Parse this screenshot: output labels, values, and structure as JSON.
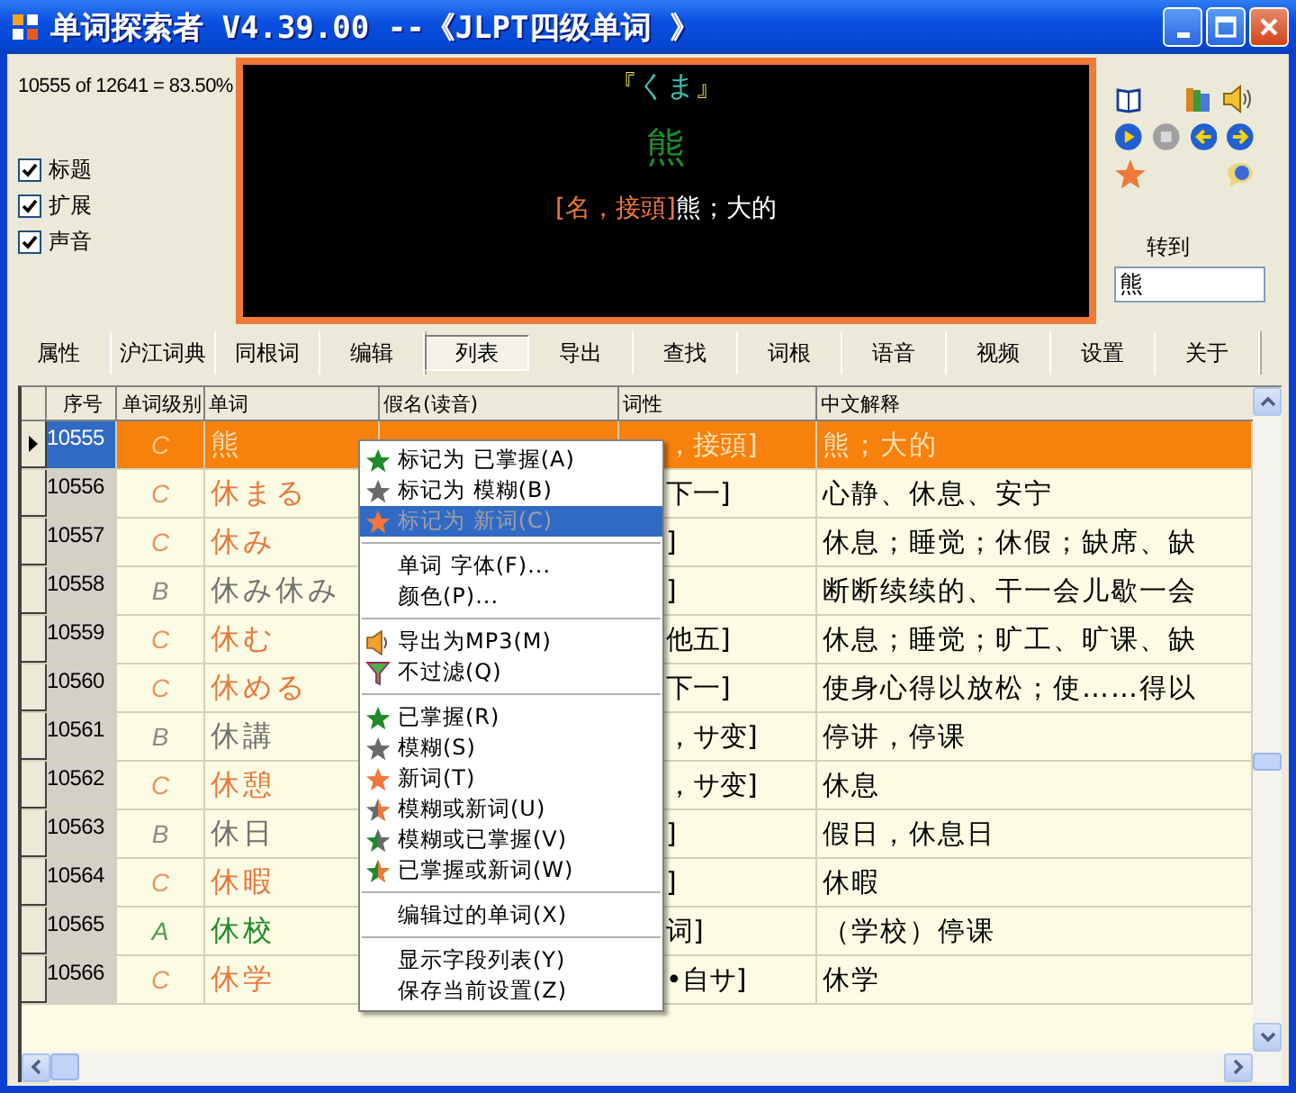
{
  "window": {
    "title": "单词探索者 V4.39.00 --《JLPT四级单词 》"
  },
  "stats": "10555 of 12641 = 83.50%",
  "options": [
    {
      "label": "标题",
      "checked": true
    },
    {
      "label": "扩展",
      "checked": true
    },
    {
      "label": "声音",
      "checked": true
    }
  ],
  "display": {
    "reading_open": "『",
    "reading": "くま",
    "reading_close": "』",
    "word": "熊",
    "pos": "[名，接頭]",
    "meaning": "熊；大的"
  },
  "goto": {
    "label": "转到",
    "value": "熊"
  },
  "tabs": [
    {
      "label": "属性",
      "selected": false
    },
    {
      "label": "沪江词典",
      "selected": false
    },
    {
      "label": "同根词",
      "selected": false
    },
    {
      "label": "编辑",
      "selected": false
    },
    {
      "label": "列表",
      "selected": true
    },
    {
      "label": "导出",
      "selected": false
    },
    {
      "label": "查找",
      "selected": false
    },
    {
      "label": "词根",
      "selected": false
    },
    {
      "label": "语音",
      "selected": false
    },
    {
      "label": "视频",
      "selected": false
    },
    {
      "label": "设置",
      "selected": false
    },
    {
      "label": "关于",
      "selected": false
    }
  ],
  "table": {
    "columns": [
      "序号",
      "单词级别",
      "单词",
      "假名(读音)",
      "词性",
      "中文解释"
    ],
    "rows": [
      {
        "id": "10555",
        "level": "C",
        "word": "熊",
        "pos": "，接頭]",
        "meaning": "熊；大的",
        "color": "#ffd9a8",
        "selected": true
      },
      {
        "id": "10556",
        "level": "C",
        "word": "休まる",
        "pos": "下一]",
        "meaning": "心静、休息、安宁",
        "color": "#e8783c",
        "selected": false
      },
      {
        "id": "10557",
        "level": "C",
        "word": "休み",
        "pos": "]",
        "meaning": "休息；睡觉；休假；缺席、缺",
        "color": "#e8783c",
        "selected": false
      },
      {
        "id": "10558",
        "level": "B",
        "word": "休み休み",
        "pos": "]",
        "meaning": "断断续续的、干一会儿歇一会",
        "color": "#707070",
        "selected": false
      },
      {
        "id": "10559",
        "level": "C",
        "word": "休む",
        "pos": "他五]",
        "meaning": "休息；睡觉；旷工、旷课、缺",
        "color": "#e8783c",
        "selected": false
      },
      {
        "id": "10560",
        "level": "C",
        "word": "休める",
        "pos": "下一]",
        "meaning": "使身心得以放松；使……得以",
        "color": "#e8783c",
        "selected": false
      },
      {
        "id": "10561",
        "level": "B",
        "word": "休講",
        "pos": "，サ变]",
        "meaning": "停讲，停课",
        "color": "#707070",
        "selected": false
      },
      {
        "id": "10562",
        "level": "C",
        "word": "休憩",
        "pos": "，サ变]",
        "meaning": "休息",
        "color": "#e8783c",
        "selected": false
      },
      {
        "id": "10563",
        "level": "B",
        "word": "休日",
        "pos": "]",
        "meaning": "假日，休息日",
        "color": "#707070",
        "selected": false
      },
      {
        "id": "10564",
        "level": "C",
        "word": "休暇",
        "pos": "]",
        "meaning": "休暇",
        "color": "#e8783c",
        "selected": false
      },
      {
        "id": "10565",
        "level": "A",
        "word": "休校",
        "pos": "词]",
        "meaning": "（学校）停课",
        "color": "#1e8a2a",
        "selected": false
      },
      {
        "id": "10566",
        "level": "C",
        "word": "休学",
        "pos": "•自サ]",
        "meaning": "休学",
        "color": "#e8783c",
        "selected": false
      }
    ]
  },
  "context_menu": [
    {
      "kind": "item",
      "label": "标记为 已掌握(A)",
      "selected": false,
      "disabled": false
    },
    {
      "kind": "item",
      "label": "标记为 模糊(B)",
      "selected": false,
      "disabled": false
    },
    {
      "kind": "item",
      "label": "标记为 新词(C)",
      "selected": true,
      "disabled": true
    },
    {
      "kind": "separator"
    },
    {
      "kind": "item",
      "label": "单词 字体(F)...",
      "selected": false,
      "disabled": false
    },
    {
      "kind": "item",
      "label": "颜色(P)...",
      "selected": false,
      "disabled": false
    },
    {
      "kind": "separator"
    },
    {
      "kind": "item",
      "label": "导出为MP3(M)",
      "selected": false,
      "disabled": false
    },
    {
      "kind": "item",
      "label": "不过滤(Q)",
      "selected": false,
      "disabled": false
    },
    {
      "kind": "separator"
    },
    {
      "kind": "item",
      "label": "已掌握(R)",
      "selected": false,
      "disabled": false
    },
    {
      "kind": "item",
      "label": "模糊(S)",
      "selected": false,
      "disabled": false
    },
    {
      "kind": "item",
      "label": "新词(T)",
      "selected": false,
      "disabled": false
    },
    {
      "kind": "item",
      "label": "模糊或新词(U)",
      "selected": false,
      "disabled": false
    },
    {
      "kind": "item",
      "label": "模糊或已掌握(V)",
      "selected": false,
      "disabled": false
    },
    {
      "kind": "item",
      "label": "已掌握或新词(W)",
      "selected": false,
      "disabled": false
    },
    {
      "kind": "separator"
    },
    {
      "kind": "item",
      "label": "编辑过的单词(X)",
      "selected": false,
      "disabled": false
    },
    {
      "kind": "separator"
    },
    {
      "kind": "item",
      "label": "显示字段列表(Y)",
      "selected": false,
      "disabled": false
    },
    {
      "kind": "item",
      "label": "保存当前设置(Z)",
      "selected": false,
      "disabled": false
    }
  ]
}
